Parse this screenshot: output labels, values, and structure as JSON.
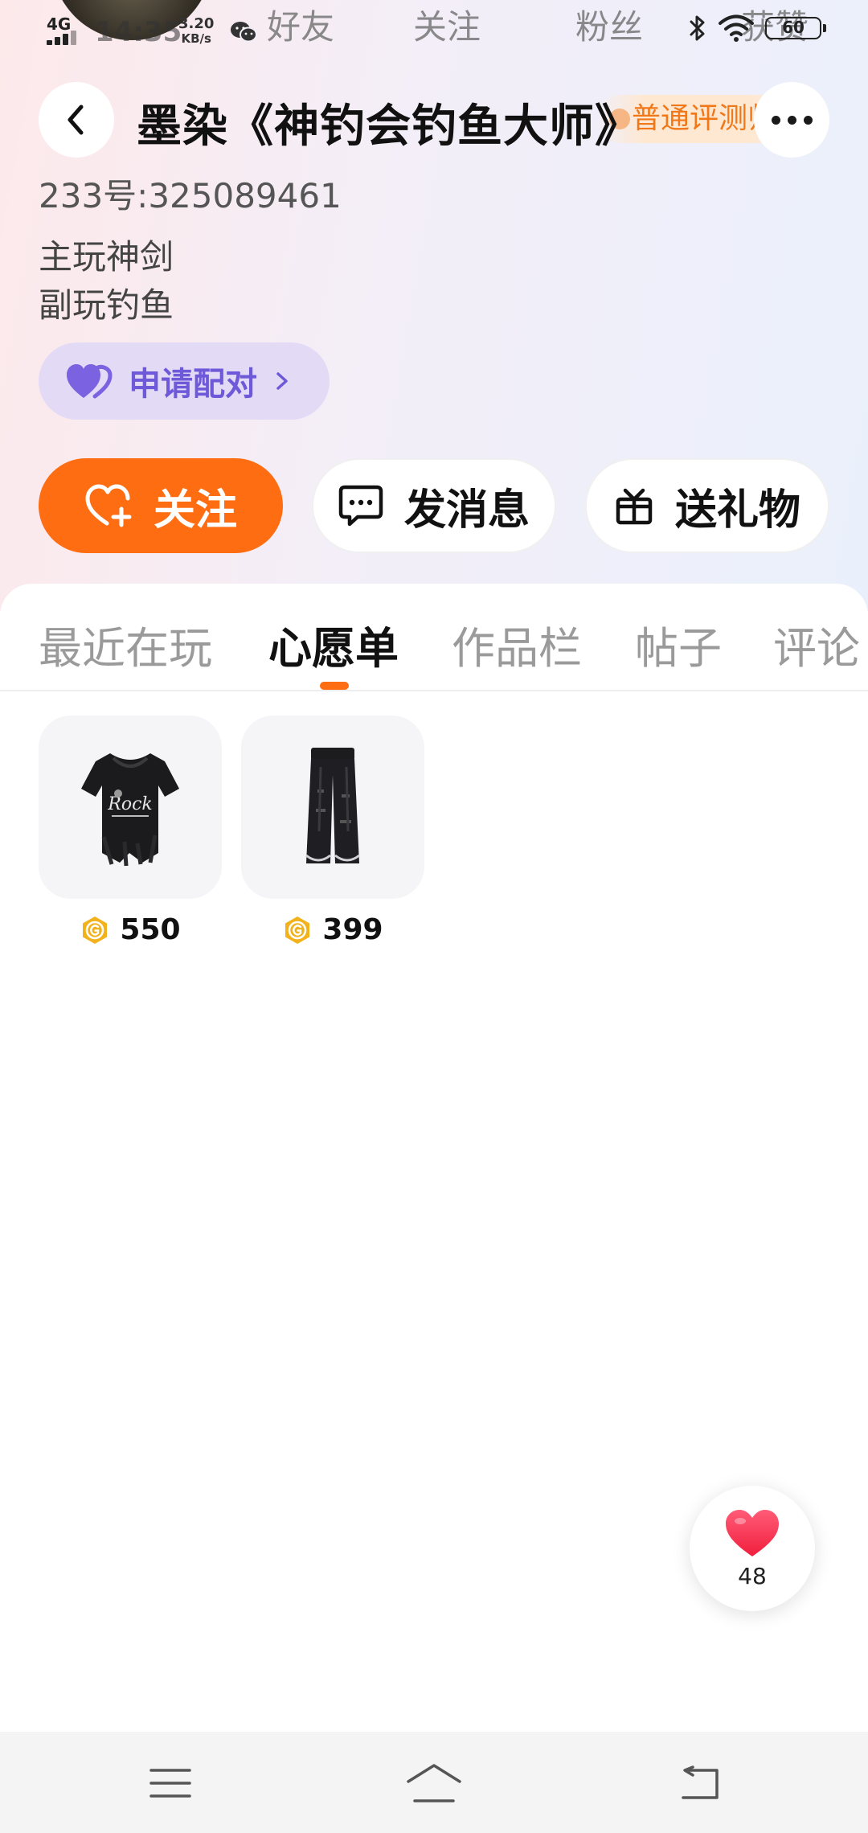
{
  "status_bar": {
    "network": "4G",
    "time": "14:35",
    "speed_value": "3.20",
    "speed_unit": "KB/s",
    "battery": "60"
  },
  "stats": {
    "friends_label": "好友",
    "following_label": "关注",
    "fans_label": "粉丝",
    "likes_label": "获赞"
  },
  "profile": {
    "name": "墨染《神钓会钓鱼大师》",
    "eval_badge": "普通评测师",
    "id_line": "233号:325089461",
    "bio_line1": "主玩神剑",
    "bio_line2": "副玩钓鱼",
    "match_button": "申请配对"
  },
  "actions": {
    "follow": "关注",
    "message": "发消息",
    "gift": "送礼物"
  },
  "tabs": [
    {
      "label": "最近在玩",
      "active": false
    },
    {
      "label": "心愿单",
      "active": true
    },
    {
      "label": "作品栏",
      "active": false
    },
    {
      "label": "帖子",
      "active": false
    },
    {
      "label": "评论",
      "active": false
    }
  ],
  "wishlist": [
    {
      "price": "550",
      "icon": "rock-tshirt-outfit"
    },
    {
      "price": "399",
      "icon": "black-pants-outfit"
    }
  ],
  "like_fab": {
    "count": "48"
  },
  "colors": {
    "accent": "#ff6d12",
    "match_purple": "#6e5ad8",
    "badge_orange": "#f07818",
    "coin_gold": "#f2b21b"
  }
}
